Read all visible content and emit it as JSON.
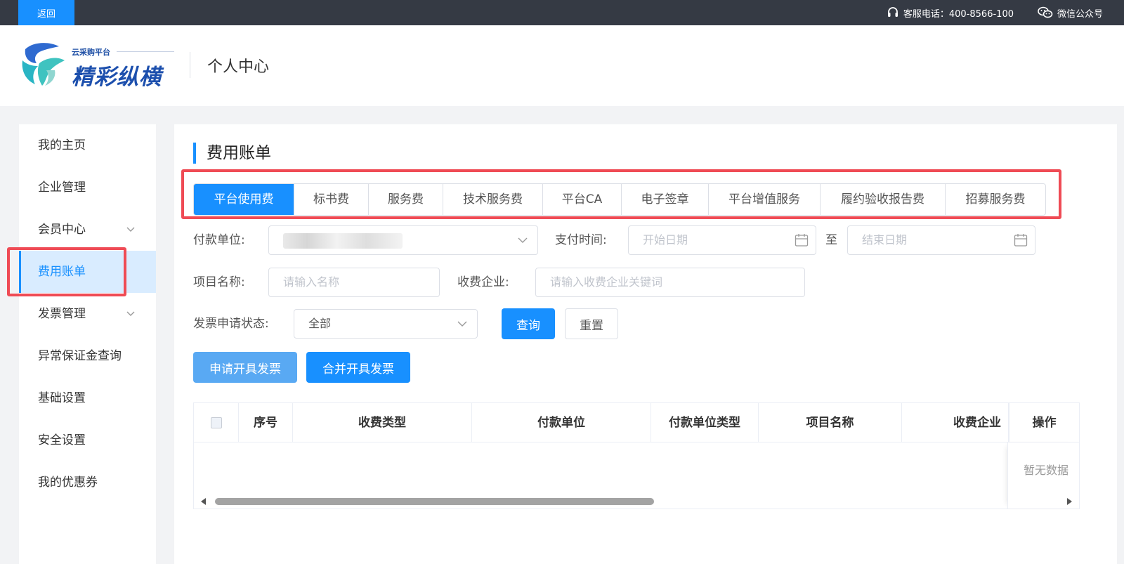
{
  "topbar": {
    "back_label": "返回",
    "service_phone": "客服电话：400-8566-100",
    "wechat_label": "微信公众号"
  },
  "header": {
    "logo_subtitle": "云采购平台",
    "logo_title": "精彩纵横",
    "page_section": "个人中心"
  },
  "sidebar": {
    "items": [
      {
        "label": "我的主页"
      },
      {
        "label": "企业管理"
      },
      {
        "label": "会员中心"
      },
      {
        "label": "费用账单"
      },
      {
        "label": "发票管理"
      },
      {
        "label": "异常保证金查询"
      },
      {
        "label": "基础设置"
      },
      {
        "label": "安全设置"
      },
      {
        "label": "我的优惠券"
      }
    ]
  },
  "main": {
    "title": "费用账单",
    "tabs": [
      {
        "label": "平台使用费"
      },
      {
        "label": "标书费"
      },
      {
        "label": "服务费"
      },
      {
        "label": "技术服务费"
      },
      {
        "label": "平台CA"
      },
      {
        "label": "电子签章"
      },
      {
        "label": "平台增值服务"
      },
      {
        "label": "履约验收报告费"
      },
      {
        "label": "招募服务费"
      }
    ],
    "filters": {
      "payer_label": "付款单位:",
      "pay_time_label": "支付时间:",
      "start_placeholder": "开始日期",
      "to_label": "至",
      "end_placeholder": "结束日期",
      "project_label": "项目名称:",
      "project_placeholder": "请输入名称",
      "charging_label": "收费企业:",
      "charging_placeholder": "请输入收费企业关键词",
      "invoice_status_label": "发票申请状态:",
      "invoice_status_value": "全部",
      "query_button": "查询",
      "reset_button": "重置"
    },
    "actions": {
      "apply_invoice": "申请开具发票",
      "merge_invoice": "合并开具发票"
    },
    "table": {
      "columns": [
        "序号",
        "收费类型",
        "付款单位",
        "付款单位类型",
        "项目名称",
        "收费企业",
        "操作"
      ],
      "empty_text": "暂无数据",
      "scroll_fraction": 0.52
    }
  },
  "colors": {
    "primary": "#1890ff",
    "highlight": "#ef4b55",
    "topbar": "#353a44"
  }
}
